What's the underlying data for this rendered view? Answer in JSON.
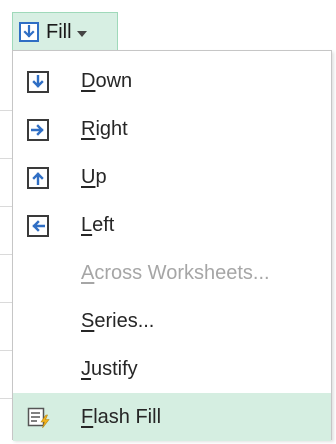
{
  "fill_button": {
    "label": "Fill",
    "icon": "fill-down-icon"
  },
  "menu": {
    "items": [
      {
        "key": "down",
        "access": "D",
        "rest": "own",
        "icon": "fill-down-icon",
        "enabled": true,
        "highlighted": false
      },
      {
        "key": "right",
        "access": "R",
        "rest": "ight",
        "icon": "fill-right-icon",
        "enabled": true,
        "highlighted": false
      },
      {
        "key": "up",
        "access": "U",
        "rest": "p",
        "icon": "fill-up-icon",
        "enabled": true,
        "highlighted": false
      },
      {
        "key": "left",
        "access": "L",
        "rest": "eft",
        "icon": "fill-left-icon",
        "enabled": true,
        "highlighted": false
      },
      {
        "key": "across-worksheets",
        "access": "A",
        "rest": "cross Worksheets...",
        "icon": "",
        "enabled": false,
        "highlighted": false
      },
      {
        "key": "series",
        "access": "S",
        "rest": "eries...",
        "icon": "",
        "enabled": true,
        "highlighted": false
      },
      {
        "key": "justify",
        "access": "J",
        "rest": "ustify",
        "icon": "",
        "enabled": true,
        "highlighted": false
      },
      {
        "key": "flash-fill",
        "access": "F",
        "rest": "lash Fill",
        "icon": "flash-fill-icon",
        "enabled": true,
        "highlighted": true
      }
    ]
  },
  "colors": {
    "arrow_blue": "#2f6ec4",
    "highlight_bg": "#d5eee1",
    "button_bg": "#d7efe3",
    "disabled_text": "#a6a6a6"
  }
}
